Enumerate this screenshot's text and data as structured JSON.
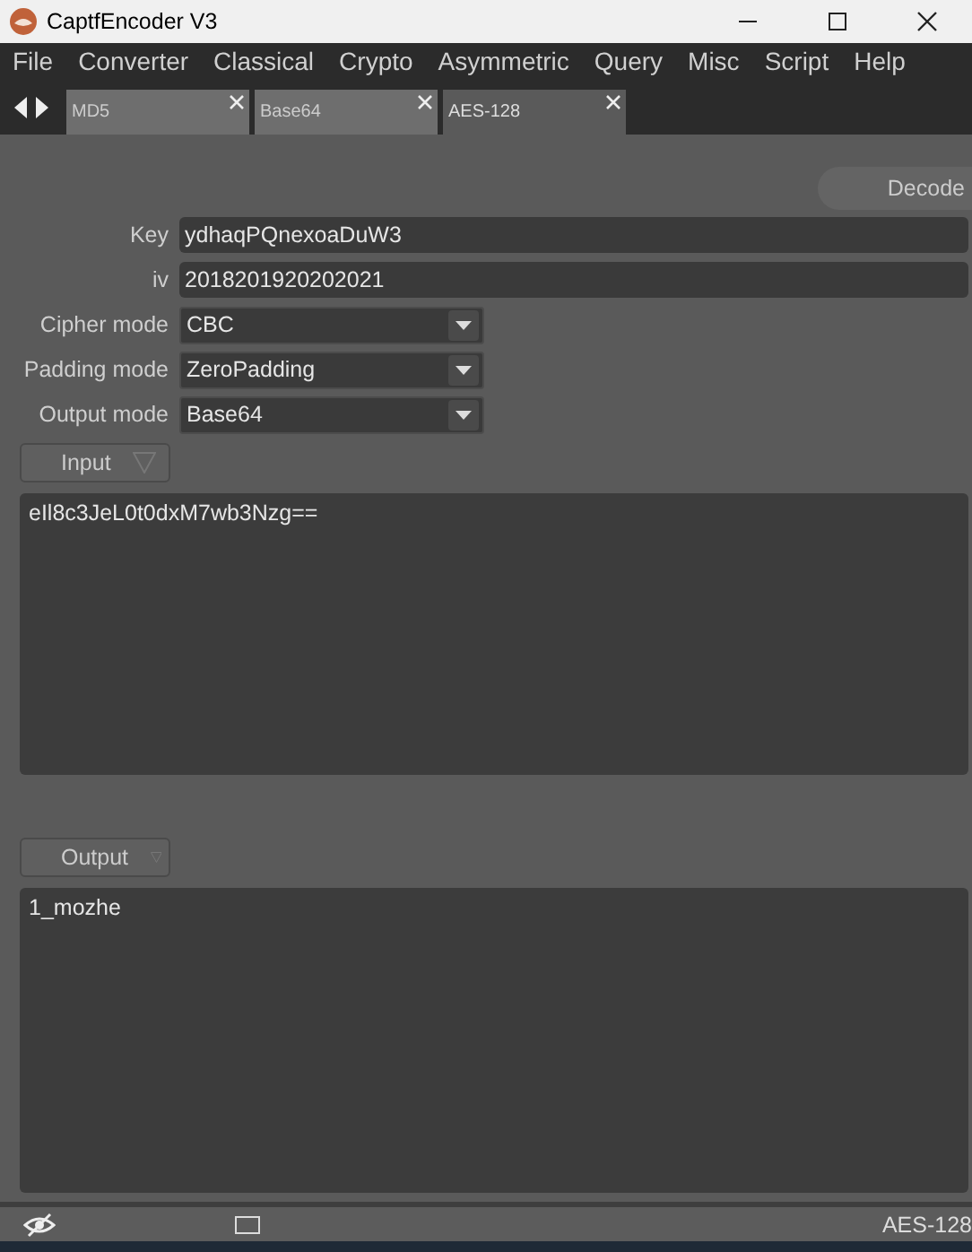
{
  "window": {
    "title": "CaptfEncoder V3"
  },
  "menu": [
    "File",
    "Converter",
    "Classical",
    "Crypto",
    "Asymmetric",
    "Query",
    "Misc",
    "Script",
    "Help"
  ],
  "tabs": [
    {
      "label": "MD5",
      "selected": false
    },
    {
      "label": "Base64",
      "selected": false
    },
    {
      "label": "AES-128",
      "selected": true
    }
  ],
  "action_button": "Decode",
  "fields": [
    {
      "kind": "text",
      "label": "Key",
      "value": "ydhaqPQnexoaDuW3"
    },
    {
      "kind": "text",
      "label": "iv",
      "value": "2018201920202021"
    },
    {
      "kind": "select",
      "label": "Cipher mode",
      "value": "CBC"
    },
    {
      "kind": "select",
      "label": "Padding mode",
      "value": "ZeroPadding"
    },
    {
      "kind": "select",
      "label": "Output mode",
      "value": "Base64"
    }
  ],
  "input": {
    "label": "Input",
    "value": "eIl8c3JeL0t0dxM7wb3Nzg=="
  },
  "output": {
    "label": "Output",
    "value": "1_mozhe"
  },
  "status_bar": {
    "text": "AES-128"
  }
}
